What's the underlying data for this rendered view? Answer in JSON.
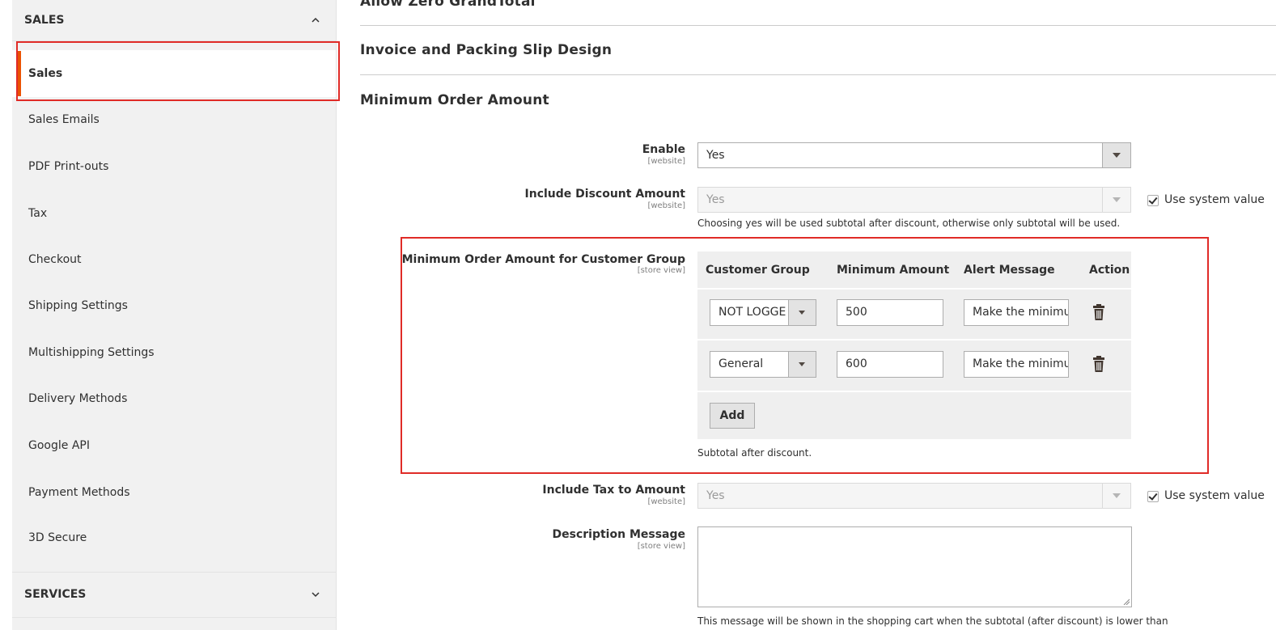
{
  "sidebar": {
    "section_title": "SALES",
    "items": [
      {
        "label": "Sales"
      },
      {
        "label": "Sales Emails"
      },
      {
        "label": "PDF Print-outs"
      },
      {
        "label": "Tax"
      },
      {
        "label": "Checkout"
      },
      {
        "label": "Shipping Settings"
      },
      {
        "label": "Multishipping Settings"
      },
      {
        "label": "Delivery Methods"
      },
      {
        "label": "Google API"
      },
      {
        "label": "Payment Methods"
      },
      {
        "label": "3D Secure"
      }
    ],
    "services_title": "SERVICES"
  },
  "main": {
    "sections": {
      "allow_zero": "Allow Zero GrandTotal",
      "invoice": "Invoice and Packing Slip Design",
      "minimum_order": "Minimum Order Amount"
    },
    "enable": {
      "label": "Enable",
      "scope": "[website]",
      "value": "Yes"
    },
    "include_discount": {
      "label": "Include Discount Amount",
      "scope": "[website]",
      "value": "Yes",
      "use_system": "Use system value",
      "note": "Choosing yes will be used subtotal after discount, otherwise only subtotal will be used."
    },
    "customer_group_amount": {
      "label": "Minimum Order Amount for Customer Group",
      "scope": "[store view]",
      "columns": [
        "Customer Group",
        "Minimum Amount",
        "Alert Message",
        "Action"
      ],
      "rows": [
        {
          "group": "NOT LOGGED IN",
          "amount": "500",
          "message": "Make the minimum"
        },
        {
          "group": "General",
          "amount": "600",
          "message": "Make the minimum"
        }
      ],
      "add_label": "Add",
      "note": "Subtotal after discount."
    },
    "include_tax": {
      "label": "Include Tax to Amount",
      "scope": "[website]",
      "value": "Yes",
      "use_system": "Use system value"
    },
    "description": {
      "label": "Description Message",
      "scope": "[store view]",
      "note": "This message will be shown in the shopping cart when the subtotal (after discount) is lower than"
    }
  },
  "colors": {
    "accent": "#eb5202",
    "highlight": "#e02b27"
  }
}
